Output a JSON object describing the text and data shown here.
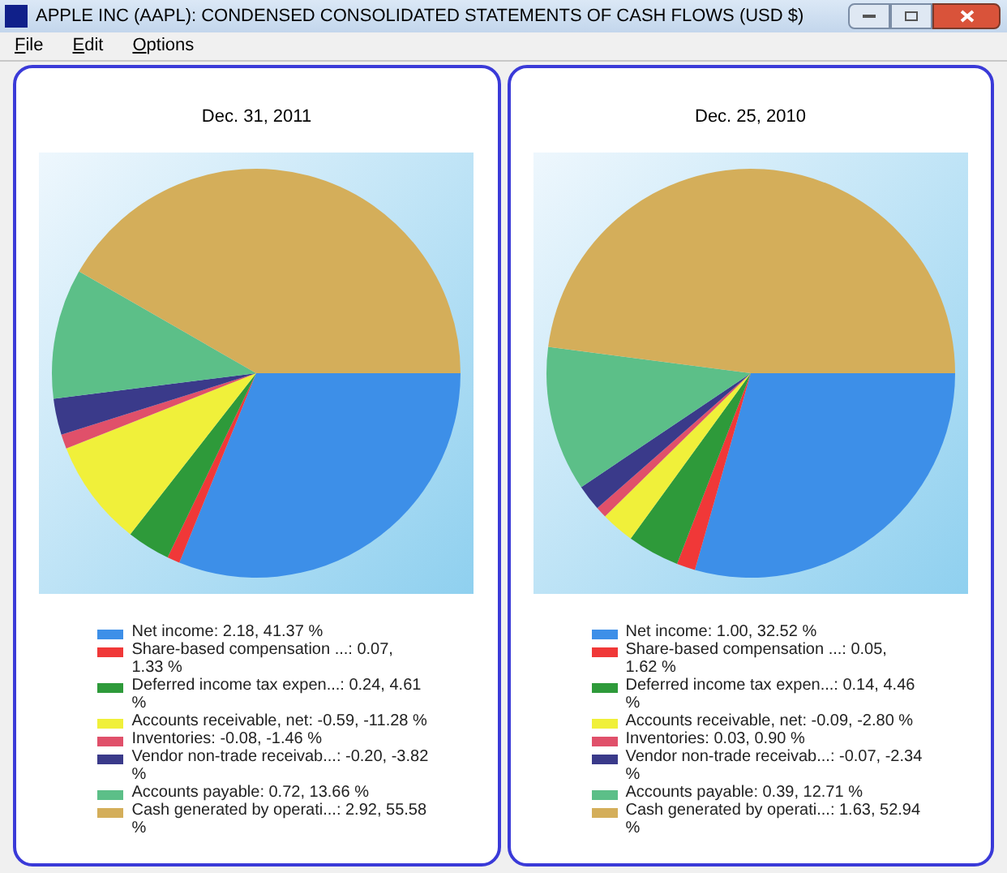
{
  "window": {
    "title": "APPLE INC (AAPL): CONDENSED CONSOLIDATED STATEMENTS OF CASH FLOWS (USD $)"
  },
  "menu": [
    {
      "label": "File"
    },
    {
      "label": "Edit"
    },
    {
      "label": "Options"
    }
  ],
  "panels": [
    {
      "chart_data": {
        "type": "pie",
        "title": "Dec. 31, 2011",
        "categories": [
          "Net income: 2.18, 41.37 %",
          "Share-based compensation ...: 0.07, 1.33 %",
          "Deferred income tax expen...: 0.24, 4.61 %",
          "Accounts receivable, net: -0.59, -11.28 %",
          "Inventories: -0.08, -1.46 %",
          "Vendor non-trade receivab...: -0.20, -3.82 %",
          "Accounts payable: 0.72, 13.66 %",
          "Cash generated by operati...: 2.92, 55.58 %"
        ],
        "values": [
          31.14,
          1.0,
          3.43,
          8.43,
          1.14,
          2.86,
          10.29,
          41.71
        ],
        "colors": [
          "#3d8fe8",
          "#f03838",
          "#2e9a3a",
          "#f0f03a",
          "#e0506a",
          "#3a3a8a",
          "#5cbf88",
          "#d4ae5a"
        ]
      }
    },
    {
      "chart_data": {
        "type": "pie",
        "title": "Dec. 25, 2010",
        "categories": [
          "Net income: 1.00, 32.52 %",
          "Share-based compensation ...: 0.05, 1.62 %",
          "Deferred income tax expen...: 0.14, 4.46 %",
          "Accounts receivable, net: -0.09, -2.80 %",
          "Inventories: 0.03, 0.90 %",
          "Vendor non-trade receivab...: -0.07, -2.34 %",
          "Accounts payable: 0.39, 12.71 %",
          "Cash generated by operati...: 1.63, 52.94 %"
        ],
        "values": [
          29.41,
          1.47,
          4.12,
          2.65,
          0.88,
          2.06,
          11.47,
          47.94
        ],
        "colors": [
          "#3d8fe8",
          "#f03838",
          "#2e9a3a",
          "#f0f03a",
          "#e0506a",
          "#3a3a8a",
          "#5cbf88",
          "#d4ae5a"
        ]
      }
    }
  ]
}
